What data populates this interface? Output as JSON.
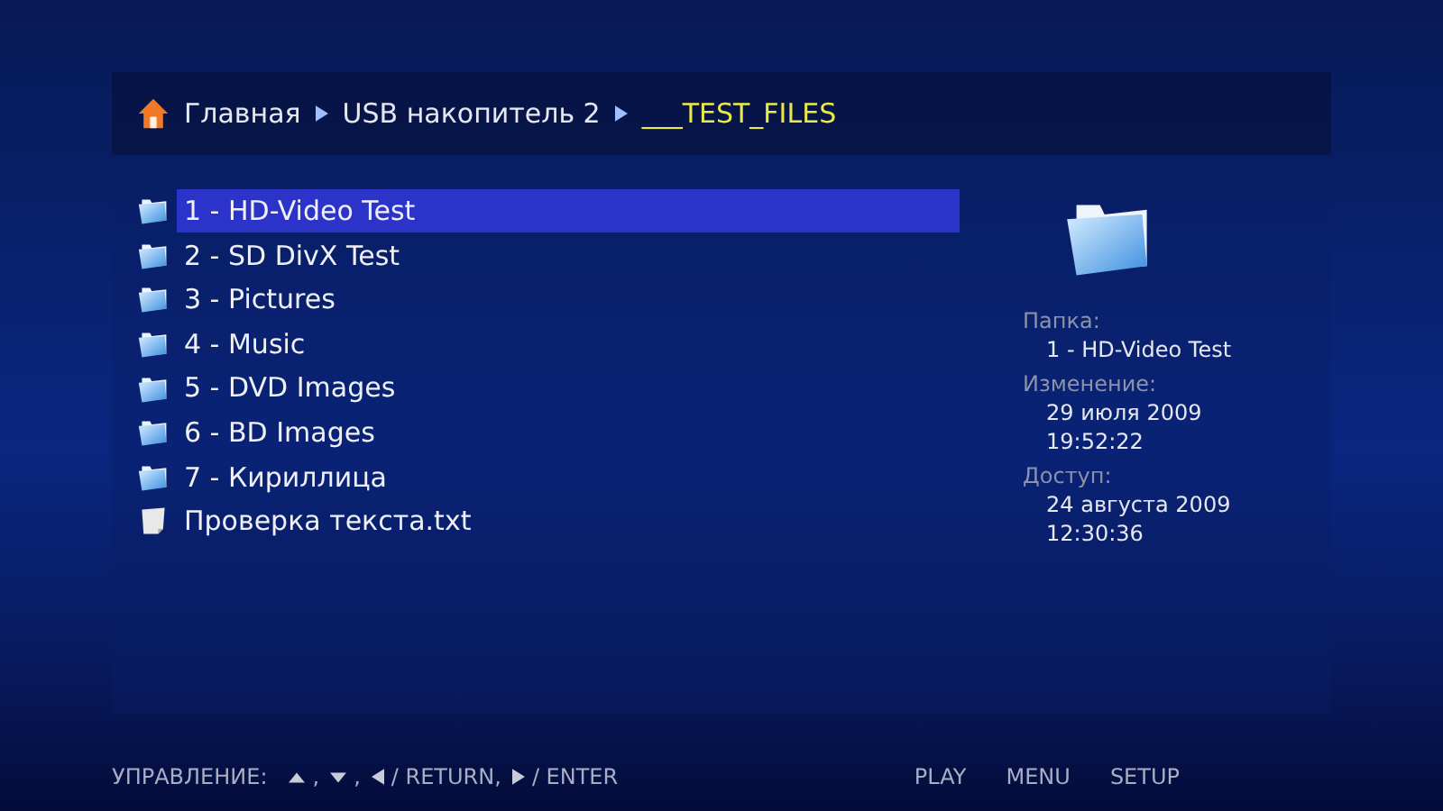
{
  "breadcrumb": [
    {
      "kind": "home",
      "label": "Главная"
    },
    {
      "kind": "folder",
      "label": "USB накопитель 2"
    },
    {
      "kind": "current",
      "label": "___TEST_FILES"
    }
  ],
  "items": [
    {
      "kind": "folder",
      "label": "1 - HD-Video Test",
      "selected": true
    },
    {
      "kind": "folder",
      "label": "2 - SD DivX Test",
      "selected": false
    },
    {
      "kind": "folder",
      "label": "3 - Pictures",
      "selected": false
    },
    {
      "kind": "folder",
      "label": "4 - Music",
      "selected": false
    },
    {
      "kind": "folder",
      "label": "5 - DVD Images",
      "selected": false
    },
    {
      "kind": "folder",
      "label": "6 - BD Images",
      "selected": false
    },
    {
      "kind": "folder",
      "label": "7 - Кириллица",
      "selected": false
    },
    {
      "kind": "file",
      "label": "Проверка текста.txt",
      "selected": false
    }
  ],
  "info": [
    {
      "label": "Папка:",
      "values": [
        "1 - HD-Video Test"
      ]
    },
    {
      "label": "Изменение:",
      "values": [
        "29 июля 2009",
        "19:52:22"
      ]
    },
    {
      "label": "Доступ:",
      "values": [
        "24 августа 2009",
        "12:30:36"
      ]
    }
  ],
  "footer": {
    "label": "УПРАВЛЕНИЕ:",
    "hints": [
      {
        "kind": "up",
        "text": ","
      },
      {
        "kind": "down",
        "text": ","
      },
      {
        "kind": "left",
        "text": "/ RETURN,"
      },
      {
        "kind": "right",
        "text": "/ ENTER"
      }
    ],
    "buttons": [
      "PLAY",
      "MENU",
      "SETUP"
    ]
  }
}
